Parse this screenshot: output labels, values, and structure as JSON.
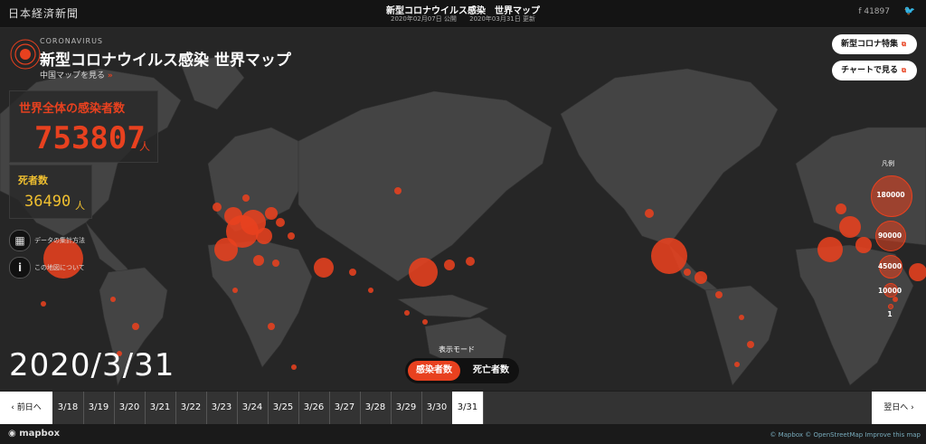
{
  "header": {
    "logo": "日本経済新聞",
    "title": "新型コロナウイルス感染　世界マップ",
    "published": "2020年02月07日 公開",
    "updated": "2020年03月31日 更新",
    "fb_count": "41897",
    "fb_icon": "facebook-icon",
    "tw_icon": "twitter-icon"
  },
  "panel": {
    "corona_label": "CORONAVIRUS",
    "title": "新型コロナウイルス感染 世界マップ",
    "china_link": "中国マップを見る",
    "infected_label": "世界全体の感染者数",
    "infected_value": "753807",
    "infected_unit": "人",
    "death_label": "死者数",
    "death_value": "36490",
    "death_unit": "人",
    "method_link": "データの集計方法",
    "about_link": "この地図について",
    "accent_color": "#e8411f",
    "death_color": "#f0c030"
  },
  "buttons": {
    "feature": "新型コロナ特集",
    "chart": "チャートで見る"
  },
  "legend": {
    "title": "凡例",
    "items": [
      "180000",
      "90000",
      "45000",
      "10000",
      "1"
    ]
  },
  "current_date": "2020/3/31",
  "mode": {
    "label": "表示モード",
    "options": [
      "感染者数",
      "死亡者数"
    ],
    "selected": "感染者数"
  },
  "timeline": {
    "prev": "前日へ",
    "next": "翌日へ",
    "dates": [
      "3/18",
      "3/19",
      "3/20",
      "3/21",
      "3/22",
      "3/23",
      "3/24",
      "3/25",
      "3/26",
      "3/27",
      "3/28",
      "3/29",
      "3/30",
      "3/31"
    ],
    "selected": "3/31"
  },
  "footer": {
    "mapbox": "mapbox",
    "attribution": "© Mapbox © OpenStreetMap Improve this map"
  }
}
